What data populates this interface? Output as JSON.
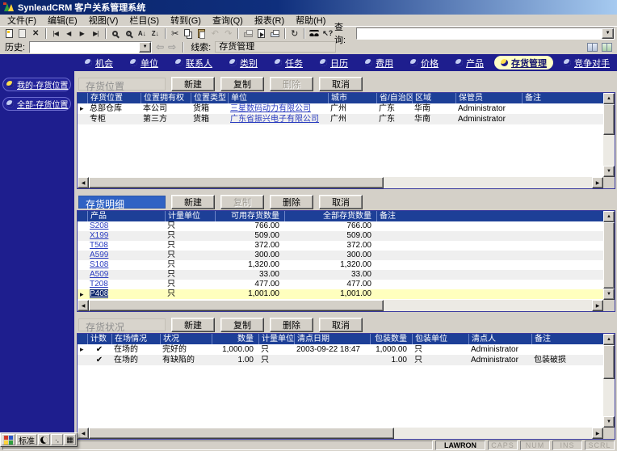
{
  "window": {
    "title": "SynleadCRM 客户关系管理系统"
  },
  "menu_bar": {
    "items": [
      "文件(F)",
      "编辑(E)",
      "视图(V)",
      "栏目(S)",
      "转到(G)",
      "查询(Q)",
      "报表(R)",
      "帮助(H)"
    ]
  },
  "toolbar": {
    "query_label": "查询:",
    "query_value": "",
    "icons": [
      "new-record-icon",
      "edit-record-icon",
      "delete-record-icon",
      "first-record-icon",
      "prev-record-icon",
      "next-record-icon",
      "last-record-icon",
      "search-icon",
      "filter-search-icon",
      "sort-ascending-icon",
      "sort-descending-icon",
      "cut-icon",
      "copy-icon",
      "paste-icon",
      "undo-icon",
      "redo-icon",
      "print-icon",
      "export-icon",
      "print-preview-icon",
      "refresh-icon",
      "find-icon",
      "context-help-icon"
    ]
  },
  "history_bar": {
    "history_label": "历史:",
    "history_value": "",
    "clue_label": "线索:",
    "clue_value": "存货管理"
  },
  "tabs": {
    "active": "存货管理",
    "items": [
      {
        "label": "机会"
      },
      {
        "label": "单位"
      },
      {
        "label": "联系人"
      },
      {
        "label": "类别"
      },
      {
        "label": "任务"
      },
      {
        "label": "日历"
      },
      {
        "label": "费用"
      },
      {
        "label": "价格"
      },
      {
        "label": "产品"
      },
      {
        "label": "存货管理"
      },
      {
        "label": "竞争对手"
      }
    ]
  },
  "sidebar": {
    "items": [
      {
        "label": "我的-存货位置",
        "active": true
      },
      {
        "label": "全部-存货位置",
        "active": false
      }
    ]
  },
  "location_section": {
    "title": "存货位置",
    "buttons": {
      "new": "新建",
      "copy": "复制",
      "delete": "删除",
      "cancel": "取消"
    },
    "columns": [
      "存货位置",
      "位置拥有权",
      "位置类型",
      "单位",
      "城市",
      "省/自治区",
      "区域",
      "保管员",
      "备注"
    ],
    "rows": [
      {
        "location": "总部仓库",
        "ownership": "本公司",
        "type": "货箱",
        "unit": "三星数码动力有限公司",
        "city": "广州",
        "province": "广东",
        "region": "华南",
        "keeper": "Administrator",
        "note": ""
      },
      {
        "location": "专柜",
        "ownership": "第三方",
        "type": "货箱",
        "unit": "广东省振兴电子有限公司",
        "city": "广州",
        "province": "广东",
        "region": "华南",
        "keeper": "Administrator",
        "note": ""
      }
    ]
  },
  "detail_section": {
    "title": "存货明细",
    "buttons": {
      "new": "新建",
      "copy": "复制",
      "delete": "删除",
      "cancel": "取消"
    },
    "columns": [
      "产品",
      "计量单位",
      "可用存货数量",
      "全部存货数量",
      "备注"
    ],
    "rows": [
      {
        "product": "S208",
        "unit": "只",
        "available": "766.00",
        "total": "766.00",
        "note": ""
      },
      {
        "product": "X199",
        "unit": "只",
        "available": "509.00",
        "total": "509.00",
        "note": ""
      },
      {
        "product": "T508",
        "unit": "只",
        "available": "372.00",
        "total": "372.00",
        "note": ""
      },
      {
        "product": "A599",
        "unit": "只",
        "available": "300.00",
        "total": "300.00",
        "note": ""
      },
      {
        "product": "S108",
        "unit": "只",
        "available": "1,320.00",
        "total": "1,320.00",
        "note": ""
      },
      {
        "product": "A509",
        "unit": "只",
        "available": "33.00",
        "total": "33.00",
        "note": ""
      },
      {
        "product": "T208",
        "unit": "只",
        "available": "477.00",
        "total": "477.00",
        "note": ""
      },
      {
        "product": "P408",
        "unit": "只",
        "available": "1,001.00",
        "total": "1,001.00",
        "note": "",
        "selected": true
      }
    ]
  },
  "status_section": {
    "title": "存货状况",
    "buttons": {
      "new": "新建",
      "copy": "复制",
      "delete": "删除",
      "cancel": "取消"
    },
    "columns": [
      "计数",
      "在场情况",
      "状况",
      "数量",
      "计量单位",
      "清点日期",
      "包装数量",
      "包装单位",
      "清点人",
      "备注"
    ],
    "rows": [
      {
        "counted": "✔",
        "presence": "在场的",
        "condition": "完好的",
        "qty": "1,000.00",
        "unit": "只",
        "date": "2003-09-22 18:47",
        "pack_qty": "1,000.00",
        "pack_unit": "只",
        "counter": "Administrator",
        "note": ""
      },
      {
        "counted": "✔",
        "presence": "在场的",
        "condition": "有缺陷的",
        "qty": "1.00",
        "unit": "只",
        "date": "",
        "pack_qty": "1.00",
        "pack_unit": "只",
        "counter": "Administrator",
        "note": "包装破损"
      }
    ]
  },
  "ime_bar": {
    "mode_label": "标准"
  },
  "status_bar": {
    "user": "LAWRON",
    "indicators": [
      "CAPS",
      "NUM",
      "INS",
      "SCRL"
    ]
  },
  "colors": {
    "navy": "#1e1e8e",
    "table_header": "#1d3f97",
    "selected_row": "#ffffbe",
    "link": "#2a3cc0",
    "active_tab_bg": "#ffffc6",
    "face": "#d4d0c8"
  }
}
